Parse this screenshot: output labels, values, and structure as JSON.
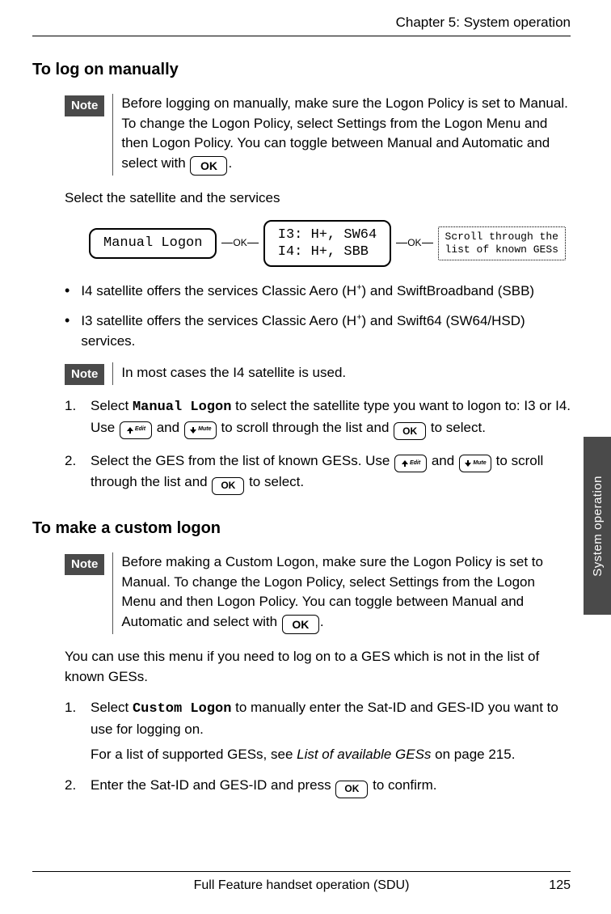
{
  "header": {
    "chapter": "Chapter 5:  System operation"
  },
  "side_tab": "System operation",
  "footer": {
    "title": "Full Feature handset operation (SDU)",
    "page": "125"
  },
  "section1": {
    "heading": "To log on manually",
    "note_label": "Note",
    "note_text_pre": "Before logging on manually, make sure the Logon Policy is set to Manual. To change the Logon Policy, select Settings from the Logon Menu and then Logon Policy. You can toggle between Manual and Automatic and select with ",
    "note_text_post": ".",
    "para1": "Select the satellite and the services",
    "flow": {
      "box1": "Manual Logon",
      "conn": "OK",
      "box2": "I3: H+, SW64\nI4: H+, SBB",
      "box3": "Scroll through the\nlist of known GESs"
    },
    "bullets": [
      {
        "pre": "I4 satellite offers the services Classic Aero (H",
        "sup": "+",
        "post": ") and SwiftBroadband (SBB)"
      },
      {
        "pre": "I3 satellite offers the services Classic Aero (H",
        "sup": "+",
        "post": ") and Swift64 (SW64/HSD) services."
      }
    ],
    "note2_label": "Note",
    "note2_text": "In most cases the I4 satellite is used.",
    "steps": [
      {
        "a": "Select ",
        "mono": "Manual Logon",
        "b": " to select the satellite type you want to logon to: I3 or I4. Use ",
        "c": " and ",
        "d": " to scroll through the list and ",
        "e": " to select."
      },
      {
        "a": "Select  the GES from the list of known GESs. Use ",
        "c": " and ",
        "d": " to scroll through the list and ",
        "e": " to select."
      }
    ]
  },
  "section2": {
    "heading": "To make a custom logon",
    "note_label": "Note",
    "note_text_pre": "Before making a Custom Logon, make sure the Logon Policy is set to Manual. To change the Logon Policy, select Settings from the Logon Menu and then Logon Policy. You can toggle between Manual and Automatic and select with ",
    "note_text_post": ".",
    "para1": "You can use this menu if you need to log on to a GES which is not in the list of known GESs.",
    "steps": [
      {
        "a": "Select ",
        "mono": "Custom Logon",
        "b": " to manually enter the Sat-ID and GES-ID you want to use for logging on.",
        "sub_a": "For a list of supported GESs, see ",
        "sub_i": "List of available GESs",
        "sub_b": " on page 215."
      },
      {
        "a": "Enter the Sat-ID and GES-ID and press ",
        "b": " to confirm."
      }
    ]
  },
  "keys": {
    "ok": "OK",
    "ok_small": "OK",
    "edit": "Edit",
    "mute": "Mute"
  }
}
